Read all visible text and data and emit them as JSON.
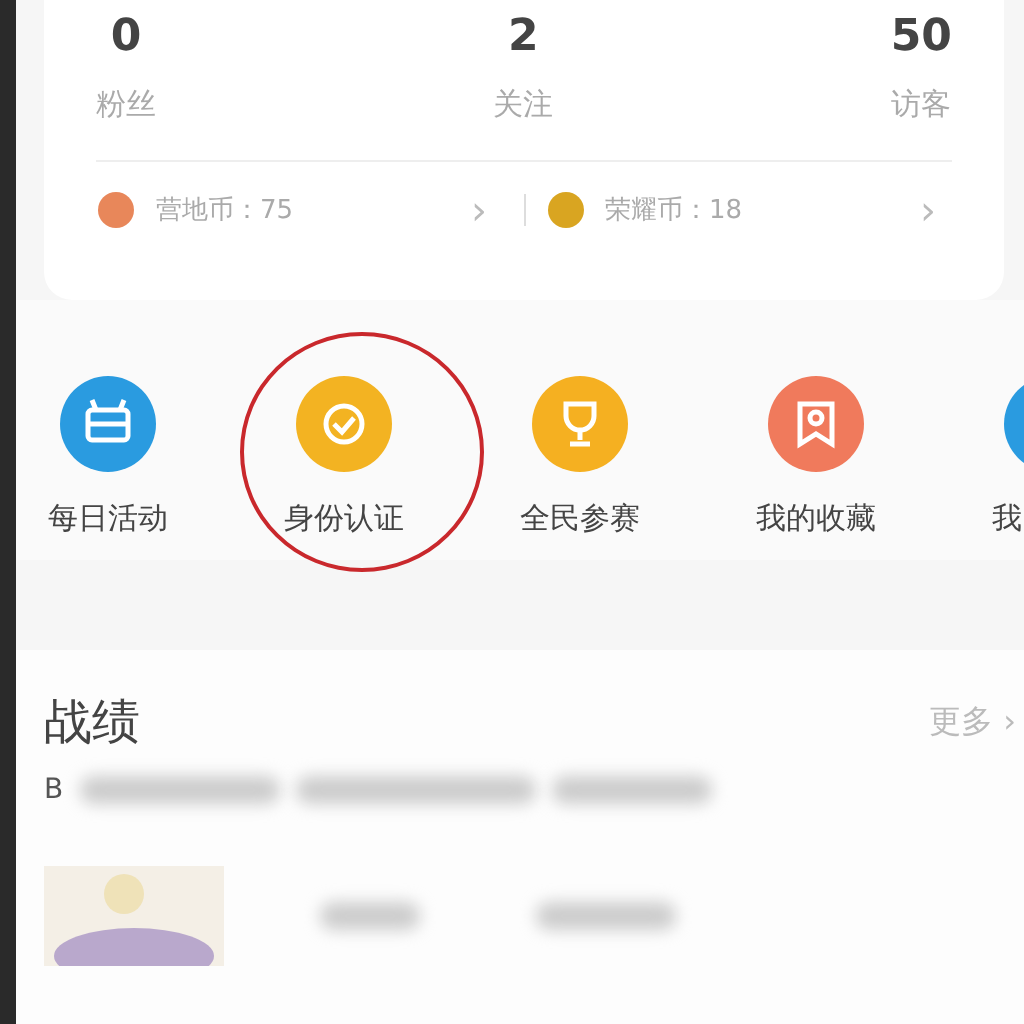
{
  "stats": [
    {
      "value": "0",
      "label": "粉丝"
    },
    {
      "value": "2",
      "label": "关注"
    },
    {
      "value": "50",
      "label": "访客"
    }
  ],
  "coins": [
    {
      "label": "营地币：75",
      "arrow": "›",
      "color": "#e8875a"
    },
    {
      "label": "荣耀币：18",
      "arrow": "›",
      "color": "#d9a521"
    }
  ],
  "shortcuts": [
    {
      "label": "每日活动",
      "kind": "gift",
      "color": "#2a9be0",
      "circled": false
    },
    {
      "label": "身份认证",
      "kind": "badge",
      "color": "#f3b322",
      "circled": true
    },
    {
      "label": "全民参赛",
      "kind": "trophy",
      "color": "#f5b021",
      "circled": false
    },
    {
      "label": "我的收藏",
      "kind": "bookmark",
      "color": "#f07a5c",
      "circled": false
    },
    {
      "label": "我",
      "kind": "blank",
      "color": "#2a9be0",
      "circled": false
    }
  ],
  "section": {
    "title": "战绩",
    "more": "更多 ›",
    "leading": "B"
  }
}
